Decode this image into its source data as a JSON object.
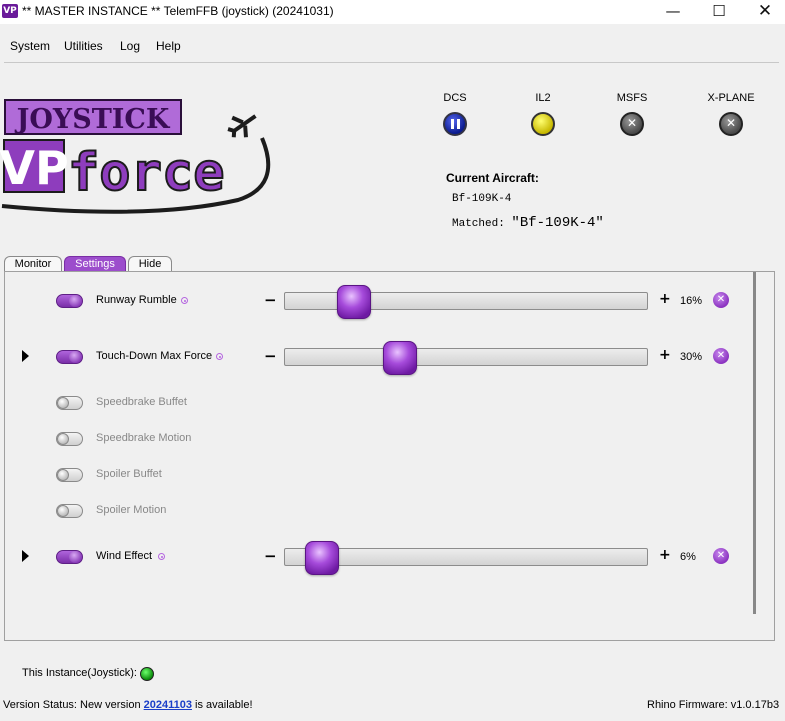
{
  "window": {
    "icon_text": "VP",
    "title": "** MASTER INSTANCE ** TelemFFB (joystick) (20241031)",
    "minimize_glyph": "—",
    "maximize_glyph": "☐",
    "close_glyph": "✕"
  },
  "menu": [
    "System",
    "Utilities",
    "Log",
    "Help"
  ],
  "logo": {
    "top_text": "JOYSTICK",
    "brand_vp": "VP",
    "brand_force": "force",
    "colors": {
      "purple": "#8e3dbd",
      "dark": "#1c1c1c"
    }
  },
  "sims": [
    {
      "label": "DCS",
      "state": "paused",
      "icon": "pause-icon"
    },
    {
      "label": "IL2",
      "state": "active",
      "icon": "yellow-led-icon"
    },
    {
      "label": "MSFS",
      "state": "off",
      "icon": "x-icon",
      "glyph": "✕"
    },
    {
      "label": "X-PLANE",
      "state": "off",
      "icon": "x-icon",
      "glyph": "✕"
    }
  ],
  "aircraft": {
    "heading": "Current Aircraft:",
    "value": "Bf-109K-4",
    "matched_label": "Matched:",
    "matched_value": "\"Bf-109K-4\""
  },
  "tabs": [
    {
      "label": "Monitor",
      "active": false
    },
    {
      "label": "Settings",
      "active": true
    },
    {
      "label": "Hide",
      "active": false
    }
  ],
  "settings": [
    {
      "label": "Runway Rumble",
      "enabled": true,
      "expandable": false,
      "value_pct": 16,
      "value_text": "16%",
      "minus": "−",
      "plus": "+",
      "reset": "✕"
    },
    {
      "label": "Touch-Down Max Force",
      "enabled": true,
      "expandable": true,
      "value_pct": 30,
      "value_text": "30%",
      "minus": "−",
      "plus": "+",
      "reset": "✕"
    },
    {
      "label": "Speedbrake Buffet",
      "enabled": false
    },
    {
      "label": "Speedbrake Motion",
      "enabled": false
    },
    {
      "label": "Spoiler Buffet",
      "enabled": false
    },
    {
      "label": "Spoiler Motion",
      "enabled": false
    },
    {
      "label": "Wind Effect",
      "enabled": true,
      "expandable": true,
      "value_pct": 6,
      "value_text": "6%",
      "minus": "−",
      "plus": "+",
      "reset": "✕"
    }
  ],
  "footer": {
    "instance_label": "This Instance(Joystick):",
    "instance_state": "green",
    "version_prefix": "Version Status: New version ",
    "version_link": "20241103",
    "version_suffix": " is available!",
    "firmware": "Rhino Firmware: v1.0.17b3"
  }
}
